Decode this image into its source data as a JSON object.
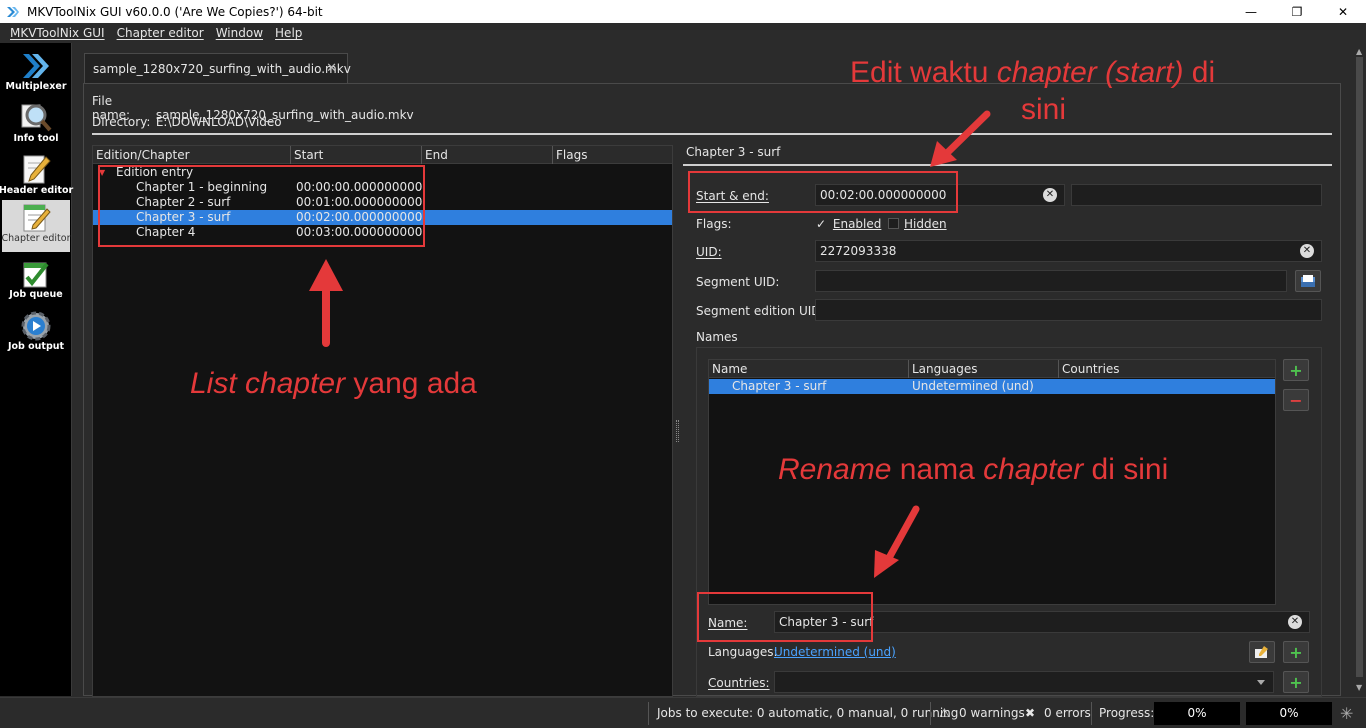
{
  "window": {
    "title": "MKVToolNix GUI v60.0.0 ('Are We Copies?') 64-bit",
    "buttons": [
      "—",
      "❐",
      "✕"
    ]
  },
  "menu": [
    "MKVToolNix GUI",
    "Chapter editor",
    "Window",
    "Help"
  ],
  "sidebar": [
    {
      "label": "Multiplexer",
      "icon": "multiplexer-icon"
    },
    {
      "label": "Info tool",
      "icon": "magnifier-icon"
    },
    {
      "label": "Header editor",
      "icon": "pencil-paper-icon"
    },
    {
      "label": "Chapter editor",
      "icon": "chapter-editor-icon",
      "active": true
    },
    {
      "label": "Job queue",
      "icon": "checklist-icon"
    },
    {
      "label": "Job output",
      "icon": "gear-play-icon"
    }
  ],
  "tab": {
    "label": "sample_1280x720_surfing_with_audio.mkv",
    "close": "✕"
  },
  "file": {
    "name_label": "File name:",
    "name": "sample_1280x720_surfing_with_audio.mkv",
    "dir_label": "Directory:",
    "dir": "E:\\DOWNLOAD\\Video"
  },
  "tree": {
    "columns": [
      "Edition/Chapter",
      "Start",
      "End",
      "Flags"
    ],
    "edition": "Edition entry",
    "rows": [
      {
        "name": "Chapter 1 - beginning",
        "start": "00:00:00.000000000"
      },
      {
        "name": "Chapter 2 - surf",
        "start": "00:01:00.000000000"
      },
      {
        "name": "Chapter 3 - surf",
        "start": "00:02:00.000000000",
        "selected": true
      },
      {
        "name": "Chapter 4",
        "start": "00:03:00.000000000"
      }
    ]
  },
  "detail": {
    "title": "Chapter 3 - surf",
    "start_end_label": "Start & end:",
    "start": "00:02:00.000000000",
    "end": "",
    "flags_label": "Flags:",
    "enabled_label": "Enabled",
    "enabled": true,
    "hidden_label": "Hidden",
    "hidden": false,
    "uid_label": "UID:",
    "uid": "2272093338",
    "segment_uid_label": "Segment UID:",
    "segment_uid": "",
    "segment_edition_uid_label": "Segment edition UID:",
    "segment_edition_uid": "",
    "names_label": "Names",
    "names_columns": [
      "Name",
      "Languages",
      "Countries"
    ],
    "names_rows": [
      {
        "name": "Chapter 3 - surf",
        "language": "Undetermined (und)",
        "country": ""
      }
    ],
    "name_label": "Name:",
    "name_value": "Chapter 3 - surf",
    "languages_label": "Languages:",
    "languages_value": "Undetermined (und)",
    "countries_label": "Countries:",
    "countries_value": ""
  },
  "status": {
    "jobs": "Jobs to execute:  0 automatic, 0 manual, 0 running",
    "warnings": "0 warnings",
    "errors": "0 errors",
    "progress_label": "Progress:",
    "progress1": "0%",
    "progress2": "0%"
  },
  "annotations": {
    "top_a": "Edit waktu ",
    "top_b": "chapter (start)",
    "top_c": " di",
    "top_line2": "sini",
    "left_a": "List chapter",
    "left_b": " yang ada",
    "rename_a": "Rename",
    "rename_b": " nama ",
    "rename_c": "chapter",
    "rename_d": " di sini"
  },
  "colors": {
    "accent": "#e4393a",
    "selection": "#2f7fde",
    "link": "#4aa3ff"
  }
}
